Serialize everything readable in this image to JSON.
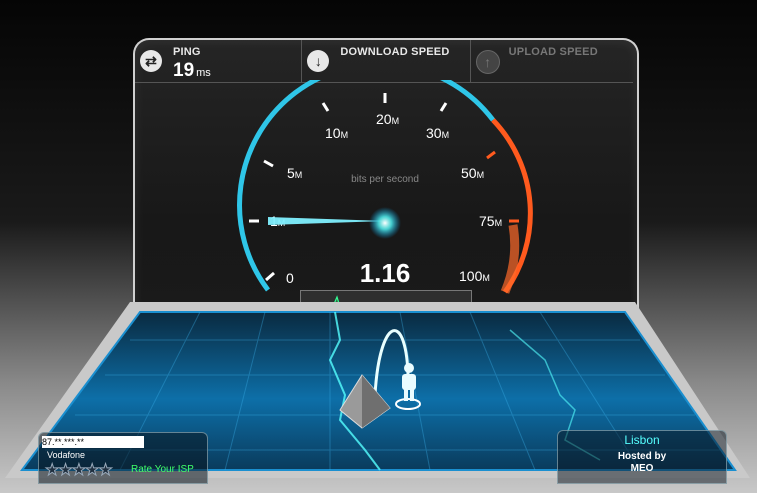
{
  "metrics": {
    "ping": {
      "label": "PING",
      "value": "19",
      "unit": "ms",
      "icon": "swap-arrows-icon"
    },
    "download": {
      "label": "DOWNLOAD SPEED",
      "icon": "down-arrow-icon"
    },
    "upload": {
      "label": "UPLOAD SPEED",
      "icon": "up-arrow-icon"
    }
  },
  "gauge": {
    "unit_label": "bits per second",
    "readout": "1.16",
    "ticks": [
      {
        "num": "0",
        "unit": ""
      },
      {
        "num": "1",
        "unit": "M"
      },
      {
        "num": "5",
        "unit": "M"
      },
      {
        "num": "10",
        "unit": "M"
      },
      {
        "num": "20",
        "unit": "M"
      },
      {
        "num": "30",
        "unit": "M"
      },
      {
        "num": "50",
        "unit": "M"
      },
      {
        "num": "75",
        "unit": "M"
      },
      {
        "num": "100",
        "unit": "M"
      }
    ],
    "colors": {
      "arc": "#2fc6e8",
      "high": "#ff5a1e",
      "needle": "#7ff0ff"
    }
  },
  "isp": {
    "ip": "87.**.***.**",
    "name": "Vodafone",
    "rate_label": "Rate Your ISP",
    "rating": 0,
    "max_rating": 5
  },
  "server": {
    "city": "Lisbon",
    "hosted_label": "Hosted by",
    "host": "MEO"
  }
}
